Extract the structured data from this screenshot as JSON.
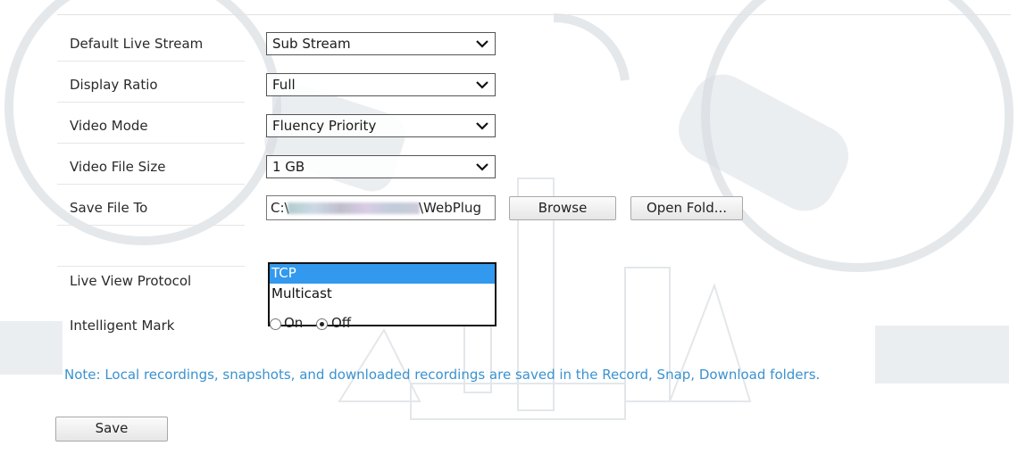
{
  "form": {
    "default_live_stream": {
      "label": "Default Live Stream",
      "value": "Sub Stream"
    },
    "display_ratio": {
      "label": "Display Ratio",
      "value": "Full"
    },
    "video_mode": {
      "label": "Video Mode",
      "value": "Fluency Priority"
    },
    "video_file_size": {
      "label": "Video File Size",
      "value": "1 GB"
    },
    "save_file_to": {
      "label": "Save File To",
      "path_prefix": "C:\\",
      "path_suffix": "\\WebPlug",
      "browse_label": "Browse",
      "open_folder_label": "Open Fold..."
    },
    "live_view_protocol": {
      "label": "Live View Protocol",
      "options": [
        "TCP",
        "Multicast"
      ],
      "selected": "TCP"
    },
    "intelligent_mark": {
      "label": "Intelligent Mark",
      "on_label": "On",
      "off_label": "Off",
      "selected": "Off"
    }
  },
  "note": "Note: Local recordings, snapshots, and downloaded recordings are saved in the Record, Snap, Download folders.",
  "save_label": "Save",
  "colors": {
    "note": "#3a92cf",
    "selected_option": "#3399ee"
  }
}
